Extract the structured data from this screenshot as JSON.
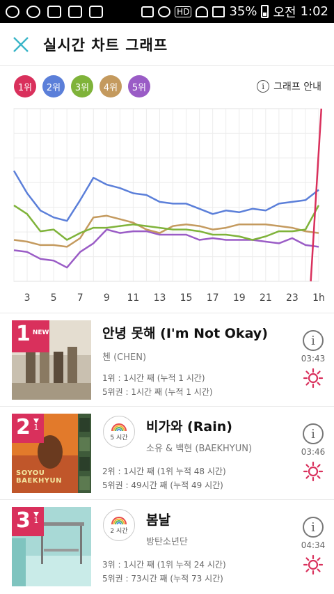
{
  "status": {
    "battery": "35%",
    "time_prefix": "오전",
    "time": "1:02",
    "hd": "HD"
  },
  "header": {
    "title": "실시간 차트 그래프"
  },
  "ranks": [
    {
      "label": "1위",
      "color": "#d9305c"
    },
    {
      "label": "2위",
      "color": "#5b7fd9"
    },
    {
      "label": "3위",
      "color": "#7fb33a"
    },
    {
      "label": "4위",
      "color": "#c49a5e"
    },
    {
      "label": "5위",
      "color": "#9a5cc6"
    }
  ],
  "guide_label": "그래프 안내",
  "chart_data": {
    "type": "line",
    "x": [
      "3",
      "5",
      "7",
      "9",
      "11",
      "13",
      "15",
      "17",
      "19",
      "21",
      "23",
      "1h"
    ],
    "x_hours": [
      2,
      3,
      4,
      5,
      6,
      7,
      8,
      9,
      10,
      11,
      12,
      13,
      14,
      15,
      16,
      17,
      18,
      19,
      20,
      21,
      22,
      23,
      24,
      25
    ],
    "grid": true,
    "series": [
      {
        "name": "1위",
        "color": "#d9305c",
        "points": [
          [
            24.4,
            0
          ],
          [
            25.2,
            100
          ]
        ]
      },
      {
        "name": "2위",
        "color": "#5b7fd9",
        "points": [
          [
            2,
            64
          ],
          [
            3,
            51
          ],
          [
            4,
            41
          ],
          [
            5,
            37
          ],
          [
            6,
            35
          ],
          [
            7,
            47
          ],
          [
            8,
            60
          ],
          [
            9,
            56
          ],
          [
            10,
            54
          ],
          [
            11,
            51
          ],
          [
            12,
            50
          ],
          [
            13,
            46
          ],
          [
            14,
            45
          ],
          [
            15,
            45
          ],
          [
            16,
            42
          ],
          [
            17,
            39
          ],
          [
            18,
            41
          ],
          [
            19,
            40
          ],
          [
            20,
            42
          ],
          [
            21,
            41
          ],
          [
            22,
            45
          ],
          [
            23,
            46
          ],
          [
            24,
            47
          ],
          [
            25,
            53
          ]
        ]
      },
      {
        "name": "3위",
        "color": "#7fb33a",
        "points": [
          [
            2,
            44
          ],
          [
            3,
            39
          ],
          [
            4,
            29
          ],
          [
            5,
            30
          ],
          [
            6,
            24
          ],
          [
            7,
            28
          ],
          [
            8,
            31
          ],
          [
            9,
            31
          ],
          [
            10,
            32
          ],
          [
            11,
            33
          ],
          [
            12,
            32
          ],
          [
            13,
            31
          ],
          [
            14,
            30
          ],
          [
            15,
            30
          ],
          [
            16,
            29
          ],
          [
            17,
            27
          ],
          [
            18,
            27
          ],
          [
            19,
            26
          ],
          [
            20,
            24
          ],
          [
            21,
            26
          ],
          [
            22,
            29
          ],
          [
            23,
            29
          ],
          [
            24,
            30
          ],
          [
            25,
            44
          ]
        ]
      },
      {
        "name": "4위",
        "color": "#c49a5e",
        "points": [
          [
            2,
            24
          ],
          [
            3,
            23
          ],
          [
            4,
            21
          ],
          [
            5,
            21
          ],
          [
            6,
            20
          ],
          [
            7,
            25
          ],
          [
            8,
            37
          ],
          [
            9,
            38
          ],
          [
            10,
            36
          ],
          [
            11,
            34
          ],
          [
            12,
            30
          ],
          [
            13,
            28
          ],
          [
            14,
            32
          ],
          [
            15,
            33
          ],
          [
            16,
            32
          ],
          [
            17,
            30
          ],
          [
            18,
            31
          ],
          [
            19,
            33
          ],
          [
            20,
            33
          ],
          [
            21,
            33
          ],
          [
            22,
            32
          ],
          [
            23,
            31
          ],
          [
            24,
            29
          ],
          [
            25,
            28
          ]
        ]
      },
      {
        "name": "5위",
        "color": "#9a5cc6",
        "points": [
          [
            2,
            18
          ],
          [
            3,
            17
          ],
          [
            4,
            13
          ],
          [
            5,
            12
          ],
          [
            6,
            8
          ],
          [
            7,
            17
          ],
          [
            8,
            22
          ],
          [
            9,
            30
          ],
          [
            10,
            28
          ],
          [
            11,
            29
          ],
          [
            12,
            29
          ],
          [
            13,
            27
          ],
          [
            14,
            27
          ],
          [
            15,
            27
          ],
          [
            16,
            24
          ],
          [
            17,
            25
          ],
          [
            18,
            24
          ],
          [
            19,
            24
          ],
          [
            20,
            24
          ],
          [
            21,
            23
          ],
          [
            22,
            22
          ],
          [
            23,
            25
          ],
          [
            24,
            21
          ],
          [
            25,
            20
          ]
        ]
      }
    ]
  },
  "songs": [
    {
      "rank": "1",
      "badge": "NEW",
      "title": "안녕 못해 (I'm Not Okay)",
      "artist": "첸 (CHEN)",
      "stat1": "1위 : 1시간 째 (누적 1 시간)",
      "stat2": "5위권 : 1시간 째 (누적 1 시간)",
      "duration": "03:43"
    },
    {
      "rank": "2",
      "move": "1",
      "hours_badge": "5 시간",
      "title": "비가와 (Rain)",
      "artist": "소유 & 백현 (BAEKHYUN)",
      "stat1": "2위 : 1시간 째 (1위 누적 48 시간)",
      "stat2": "5위권 : 49시간 째 (누적 49 시간)",
      "duration": "03:46",
      "album_text": "SOYOU BAEKHYUN"
    },
    {
      "rank": "3",
      "move": "1",
      "hours_badge": "2 시간",
      "title": "봄날",
      "artist": "방탄소년단",
      "stat1": "3위 : 1시간 째 (1위 누적 24 시간)",
      "stat2": "5위권 : 73시간 째 (누적 73 시간)",
      "duration": "04:34"
    }
  ]
}
